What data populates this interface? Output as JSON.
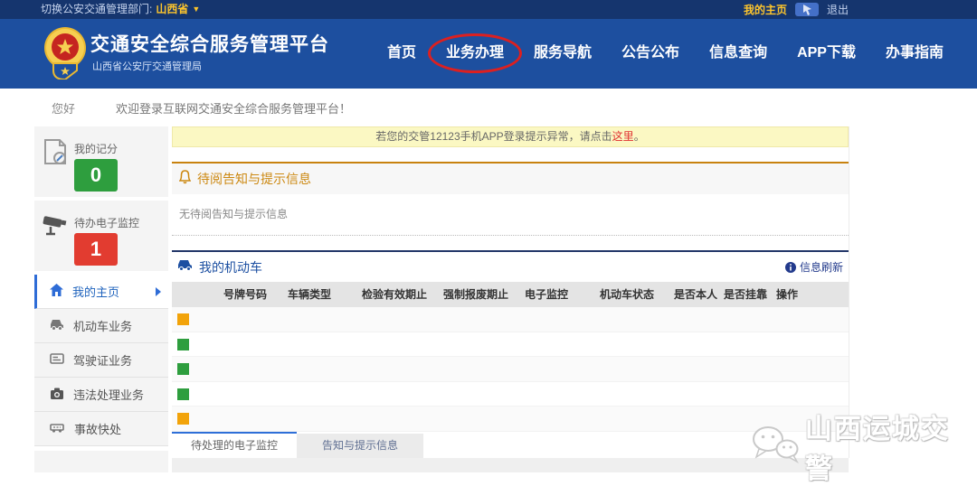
{
  "colors": {
    "topbar_bg": "#15356e",
    "header_bg": "#1d4f9f",
    "accent_yellow": "#fdc52c",
    "annotation_red": "#dc2020",
    "notice_bg": "#fbf8c3",
    "alert_orange": "#cc8811",
    "section_navy": "#223668",
    "link_blue": "#1c4fa1",
    "badge_green": "#2e9e3e",
    "badge_red": "#e23c30",
    "status_orange": "#f2a30a",
    "status_green": "#2e9e3e"
  },
  "topbar": {
    "switch_label": "切换公安交通管理部门:",
    "region": "山西省",
    "my_home": "我的主页",
    "logout": "退出"
  },
  "header": {
    "title": "交通安全综合服务管理平台",
    "subtitle": "山西省公安厅交通管理局",
    "nav": [
      {
        "label": "首页"
      },
      {
        "label": "业务办理",
        "annotated": true
      },
      {
        "label": "服务导航"
      },
      {
        "label": "公告公布"
      },
      {
        "label": "信息查询"
      },
      {
        "label": "APP下载"
      },
      {
        "label": "办事指南"
      }
    ]
  },
  "welcome": {
    "greeting": "您好",
    "message": "欢迎登录互联网交通安全综合服务管理平台！"
  },
  "sidebar": {
    "score": {
      "label": "我的记分",
      "value": "0"
    },
    "monitor": {
      "label": "待办电子监控",
      "value": "1"
    },
    "menu": [
      {
        "label": "我的主页",
        "active": true
      },
      {
        "label": "机动车业务",
        "active": false
      },
      {
        "label": "驾驶证业务",
        "active": false
      },
      {
        "label": "违法处理业务",
        "active": false
      },
      {
        "label": "事故快处",
        "active": false
      }
    ]
  },
  "main": {
    "notice": {
      "text": "若您的交管12123手机APP登录提示异常，请点击",
      "link": "这里",
      "suffix": "。"
    },
    "alerts": {
      "title": "待阅告知与提示信息",
      "empty_text": "无待阅告知与提示信息"
    },
    "vehicles": {
      "title": "我的机动车",
      "refresh_label": "信息刷新",
      "columns": [
        "号牌号码",
        "车辆类型",
        "检验有效期止",
        "强制报废期止",
        "电子监控",
        "机动车状态",
        "是否本人",
        "是否挂靠",
        "操作"
      ],
      "rows": [
        {
          "status_color": "#f2a30a"
        },
        {
          "status_color": "#2e9e3e"
        },
        {
          "status_color": "#2e9e3e"
        },
        {
          "status_color": "#2e9e3e"
        },
        {
          "status_color": "#f2a30a"
        }
      ]
    },
    "tabs": [
      {
        "label": "待处理的电子监控",
        "active": true
      },
      {
        "label": "告知与提示信息",
        "active": false
      }
    ]
  },
  "watermark": {
    "text": "山西运城交警"
  }
}
